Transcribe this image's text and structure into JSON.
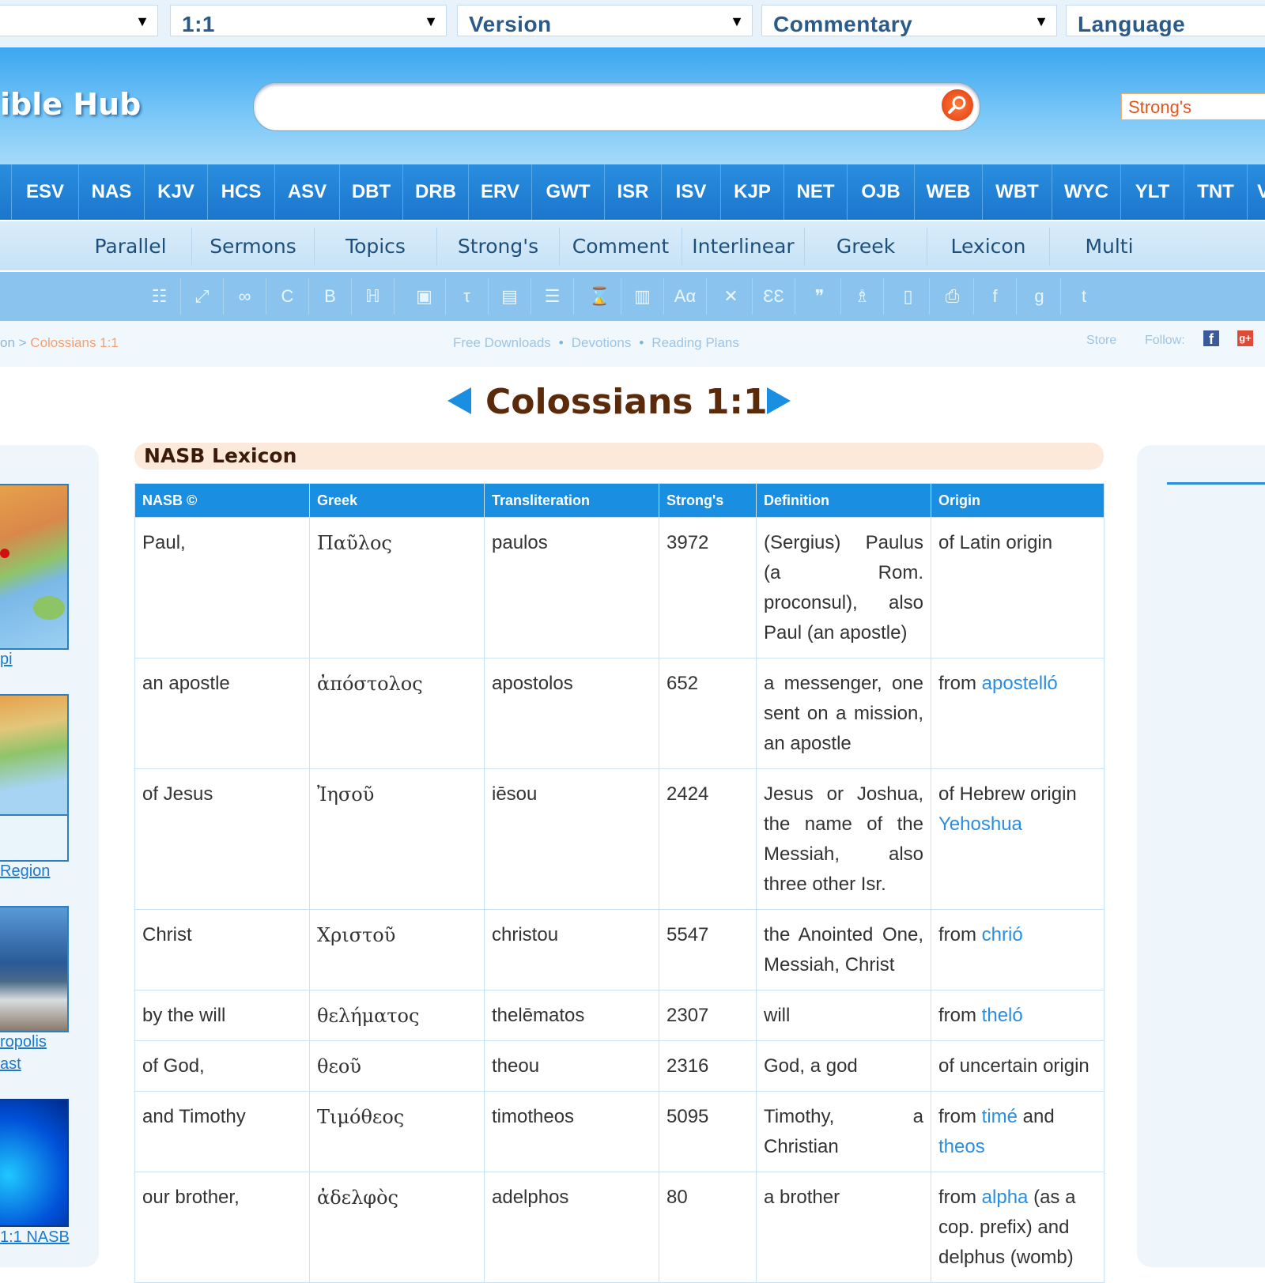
{
  "topbar": {
    "select1": "",
    "select2": "1:1",
    "select3": "Version",
    "select4": "Commentary",
    "select5": "Language"
  },
  "header": {
    "logo": "ible Hub",
    "search_value": "",
    "strongs_label": "Strong's"
  },
  "versions": [
    "ESV",
    "NAS",
    "KJV",
    "HCS",
    "ASV",
    "DBT",
    "DRB",
    "ERV",
    "GWT",
    "ISR",
    "ISV",
    "KJP",
    "NET",
    "OJB",
    "WEB",
    "WBT",
    "WYC",
    "YLT",
    "TNT",
    "V"
  ],
  "nav": [
    "Parallel",
    "Sermons",
    "Topics",
    "Strong's",
    "Comment",
    "Interlinear",
    "Greek",
    "Lexicon",
    "Multi"
  ],
  "toolbar_icons": [
    "grid-icon",
    "expand-icon",
    "link-icon",
    "c-icon",
    "b-icon",
    "hebrew-icon",
    "image-icon",
    "tau-icon",
    "book-icon",
    "list-icon",
    "hourglass-icon",
    "chart-icon",
    "translate-icon",
    "tools-icon",
    "columns-icon",
    "quote-icon",
    "org-icon",
    "mobile-icon",
    "print-icon",
    "facebook-icon",
    "google-plus-icon",
    "twitter-icon"
  ],
  "breadcrumb": {
    "prefix": "on > ",
    "current": "Colossians 1:1"
  },
  "links": [
    "Free Downloads",
    "Devotions",
    "Reading Plans"
  ],
  "store": "Store",
  "follow": "Follow:",
  "page_title": "Colossians 1:1",
  "sidebar_captions": [
    "pi",
    "Region",
    "ropolis",
    "ast",
    "1:1 NASB"
  ],
  "lexicon_title": "NASB Lexicon",
  "table": {
    "headers": [
      "NASB ©",
      "Greek",
      "Transliteration",
      "Strong's",
      "Definition",
      "Origin"
    ],
    "rows": [
      {
        "nasb": "Paul,",
        "greek": "Παῦλος",
        "translit": "paulos",
        "strongs": "3972",
        "definition": "(Sergius) Paulus (a Rom. proconsul), also Paul (an apostle)",
        "origin": [
          {
            "t": "of Latin origin"
          }
        ]
      },
      {
        "nasb": "an apostle",
        "greek": "ἀπόστολος",
        "translit": "apostolos",
        "strongs": "652",
        "definition": "a messenger, one sent on a mission, an apostle",
        "origin": [
          {
            "t": "from "
          },
          {
            "l": "apostelló"
          }
        ]
      },
      {
        "nasb": "of Jesus",
        "greek": "Ἰησοῦ",
        "translit": "iēsou",
        "strongs": "2424",
        "definition": "Jesus or Joshua, the name of the Messiah, also three other Isr.",
        "origin": [
          {
            "t": "of Hebrew origin "
          },
          {
            "l": "Yehoshua"
          }
        ]
      },
      {
        "nasb": "Christ",
        "greek": "Χριστοῦ",
        "translit": "christou",
        "strongs": "5547",
        "definition": "the Anointed One, Messiah, Christ",
        "origin": [
          {
            "t": "from "
          },
          {
            "l": "chrió"
          }
        ]
      },
      {
        "nasb": "by the will",
        "greek": "θελήματος",
        "translit": "thelēmatos",
        "strongs": "2307",
        "definition": "will",
        "origin": [
          {
            "t": "from "
          },
          {
            "l": "theló"
          }
        ]
      },
      {
        "nasb": "of God,",
        "greek": "θεοῦ",
        "translit": "theou",
        "strongs": "2316",
        "definition": "God, a god",
        "origin": [
          {
            "t": "of uncertain origin"
          }
        ]
      },
      {
        "nasb": "and Timothy",
        "greek": "Τιμόθεος",
        "translit": "timotheos",
        "strongs": "5095",
        "definition": "Timothy, a Christian",
        "origin": [
          {
            "t": "from "
          },
          {
            "l": "timé"
          },
          {
            "t": " and "
          },
          {
            "l": "theos"
          }
        ]
      },
      {
        "nasb": "our brother,",
        "greek": "ἀδελφὸς",
        "translit": "adelphos",
        "strongs": "80",
        "definition": "a brother",
        "origin": [
          {
            "t": "from "
          },
          {
            "l": "alpha"
          },
          {
            "t": " (as a cop. prefix) and delphus (womb)"
          }
        ]
      }
    ]
  }
}
